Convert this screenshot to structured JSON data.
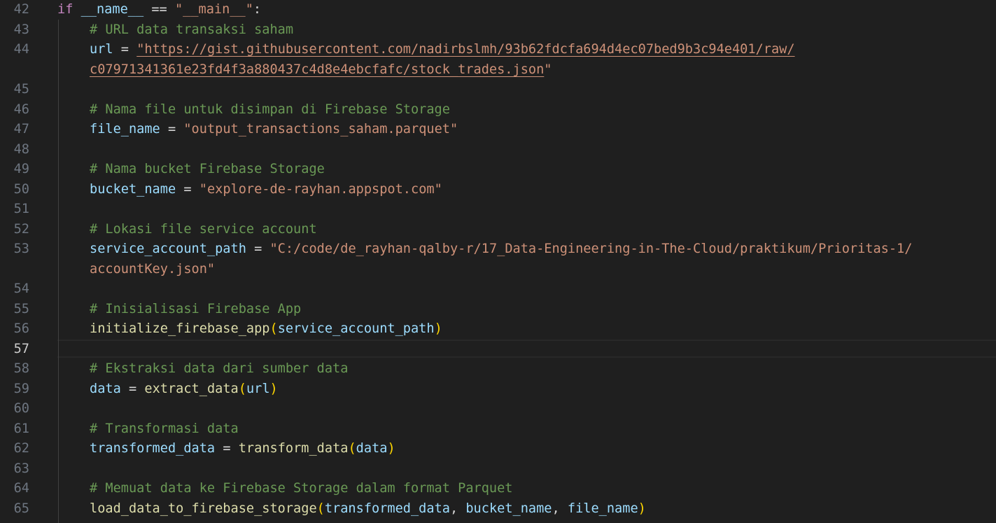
{
  "editor": {
    "active_line": "57",
    "lines": [
      {
        "num": "42"
      },
      {
        "num": "43"
      },
      {
        "num": "44"
      },
      {
        "num": "45"
      },
      {
        "num": "46"
      },
      {
        "num": "47"
      },
      {
        "num": "48"
      },
      {
        "num": "49"
      },
      {
        "num": "50"
      },
      {
        "num": "51"
      },
      {
        "num": "52"
      },
      {
        "num": "53"
      },
      {
        "num": "54"
      },
      {
        "num": "55"
      },
      {
        "num": "56"
      },
      {
        "num": "57"
      },
      {
        "num": "58"
      },
      {
        "num": "59"
      },
      {
        "num": "60"
      },
      {
        "num": "61"
      },
      {
        "num": "62"
      },
      {
        "num": "63"
      },
      {
        "num": "64"
      },
      {
        "num": "65"
      }
    ],
    "code": {
      "l42": {
        "kw": "if",
        "dunder": "__name__",
        "op": "==",
        "str": "\"__main__\"",
        "colon": ":"
      },
      "l43": {
        "comment": "# URL data transaksi saham"
      },
      "l44": {
        "var": "url",
        "op": "=",
        "str_a": "\"https://gist.githubusercontent.com/nadirbslmh/93b62fdcfa694d4ec07bed9b3c94e401/raw/",
        "str_b": "c07971341361e23fd4f3a880437c4d8e4ebcfafc/stock_trades.json",
        "quote": "\""
      },
      "l46": {
        "comment": "# Nama file untuk disimpan di Firebase Storage"
      },
      "l47": {
        "var": "file_name",
        "op": "=",
        "str": "\"output_transactions_saham.parquet\""
      },
      "l49": {
        "comment": "# Nama bucket Firebase Storage"
      },
      "l50": {
        "var": "bucket_name",
        "op": "=",
        "str": "\"explore-de-rayhan.appspot.com\""
      },
      "l52": {
        "comment": "# Lokasi file service account"
      },
      "l53": {
        "var": "service_account_path",
        "op": "=",
        "str_a": "\"C:/code/de_rayhan-qalby-r/17_Data-Engineering-in-The-Cloud/praktikum/Prioritas-1/",
        "str_b": "accountKey.json\""
      },
      "l55": {
        "comment": "# Inisialisasi Firebase App"
      },
      "l56": {
        "fn": "initialize_firebase_app",
        "open": "(",
        "arg": "service_account_path",
        "close": ")"
      },
      "l58": {
        "comment": "# Ekstraksi data dari sumber data"
      },
      "l59": {
        "var": "data",
        "op": "=",
        "fn": "extract_data",
        "open": "(",
        "arg": "url",
        "close": ")"
      },
      "l61": {
        "comment": "# Transformasi data"
      },
      "l62": {
        "var": "transformed_data",
        "op": "=",
        "fn": "transform_data",
        "open": "(",
        "arg": "data",
        "close": ")"
      },
      "l64": {
        "comment": "# Memuat data ke Firebase Storage dalam format Parquet"
      },
      "l65": {
        "fn": "load_data_to_firebase_storage",
        "open": "(",
        "arg1": "transformed_data",
        "sep1": ", ",
        "arg2": "bucket_name",
        "sep2": ", ",
        "arg3": "file_name",
        "close": ")"
      }
    }
  }
}
